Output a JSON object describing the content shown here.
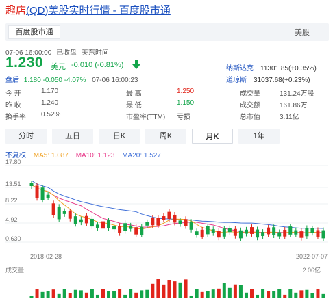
{
  "title": {
    "prefix": "趣店",
    "link": "(QD)美股实时行情 - 百度股市通"
  },
  "tabs": {
    "active": "百度股市通",
    "right": "美股"
  },
  "status": {
    "time": "07-06 16:00:00",
    "state": "已收盘",
    "zone": "美东时间"
  },
  "price": {
    "last": "1.230",
    "unit": "美元",
    "change": "-0.010",
    "change_pct": "(-0.81%)",
    "postmarket_label": "盘后",
    "postmarket": "1.180  -0.050  -4.07%",
    "postmarket_time": "07-06 16:00:23"
  },
  "indices": [
    {
      "name": "纳斯达克",
      "value": "11301.85(+0.35%)"
    },
    {
      "name": "道琼斯",
      "value": "31037.68(+0.23%)"
    }
  ],
  "stats": [
    {
      "label": "今  开",
      "value": "1.170",
      "tone": ""
    },
    {
      "label": "最  高",
      "value": "1.250",
      "tone": "red"
    },
    {
      "label": "成交量",
      "value": "131.24万股",
      "tone": ""
    },
    {
      "label": "昨  收",
      "value": "1.240",
      "tone": ""
    },
    {
      "label": "最  低",
      "value": "1.150",
      "tone": "green"
    },
    {
      "label": "成交额",
      "value": "161.86万",
      "tone": ""
    },
    {
      "label": "换手率",
      "value": "0.52%",
      "tone": ""
    },
    {
      "label": "市盈率(TTM)",
      "value": "亏损",
      "tone": ""
    },
    {
      "label": "总市值",
      "value": "3.11亿",
      "tone": ""
    }
  ],
  "periods": [
    "分时",
    "五日",
    "日K",
    "周K",
    "月K",
    "1年"
  ],
  "active_period": "月K",
  "ma": {
    "adj": "不复权",
    "ma5": "MA5: 1.087",
    "ma10": "MA10: 1.123",
    "ma20": "MA20: 1.527",
    "colors": {
      "ma5": "#f0a020",
      "ma10": "#e83a8a",
      "ma20": "#3f6fd8"
    }
  },
  "chart_data": {
    "type": "candlestick",
    "y_ticks": [
      "17.80",
      "13.51",
      "8.22",
      "4.92",
      "0.630"
    ],
    "x_labels": [
      "2018-02-28",
      "2022-07-07"
    ],
    "volume_label": "成交量",
    "volume_max": "2.06亿"
  }
}
